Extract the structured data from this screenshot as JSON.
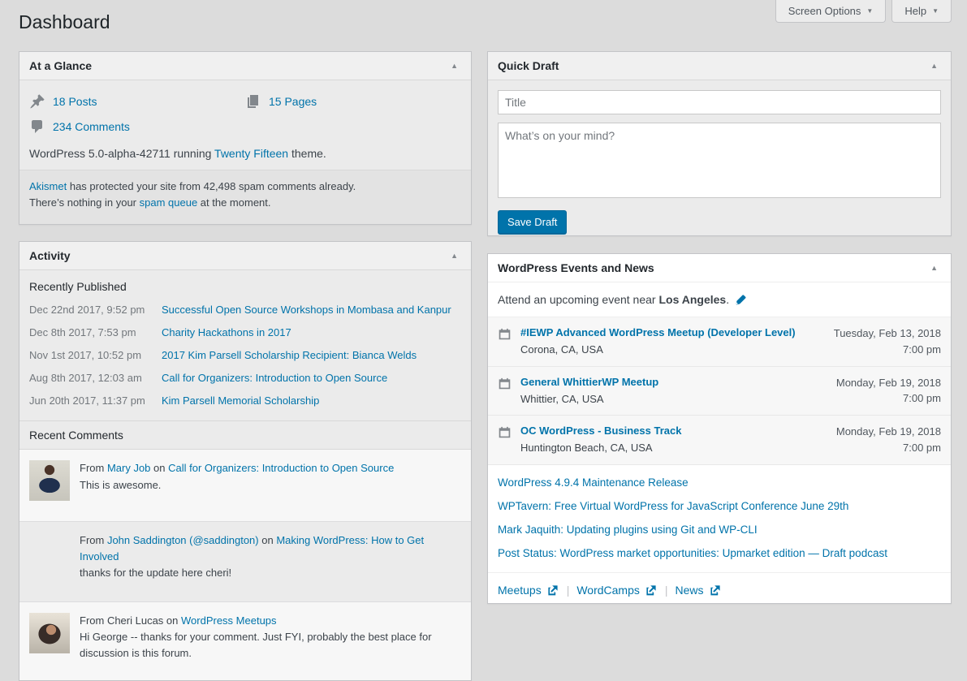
{
  "page": {
    "title": "Dashboard"
  },
  "toolbar": {
    "screen_options_label": "Screen Options",
    "help_label": "Help"
  },
  "icons": {
    "caret_down": "▼",
    "collapse_up": "▲",
    "divider": "|"
  },
  "at_a_glance": {
    "title": "At a Glance",
    "posts_link": "18 Posts",
    "pages_link": "15 Pages",
    "comments_link": "234 Comments",
    "version_prefix": "WordPress 5.0-alpha-42711 running ",
    "theme_link": "Twenty Fifteen",
    "version_suffix": " theme.",
    "akismet_link": "Akismet",
    "akismet_line1_rest": " has protected your site from 42,498 spam comments already.",
    "akismet_line2_prefix": "There’s nothing in your ",
    "spam_queue_link": "spam queue",
    "akismet_line2_suffix": " at the moment."
  },
  "activity": {
    "title": "Activity",
    "published_heading": "Recently Published",
    "published": [
      {
        "date": "Dec 22nd 2017, 9:52 pm",
        "title": "Successful Open Source Workshops in Mombasa and Kanpur"
      },
      {
        "date": "Dec 8th 2017, 7:53 pm",
        "title": "Charity Hackathons in 2017"
      },
      {
        "date": "Nov 1st 2017, 10:52 pm",
        "title": "2017 Kim Parsell Scholarship Recipient: Bianca Welds"
      },
      {
        "date": "Aug 8th 2017, 12:03 am",
        "title": "Call for Organizers: Introduction to Open Source"
      },
      {
        "date": "Jun 20th 2017, 11:37 pm",
        "title": "Kim Parsell Memorial Scholarship"
      }
    ],
    "comments_heading": "Recent Comments",
    "comments": [
      {
        "from": "From ",
        "author": "Mary Job",
        "on": " on ",
        "post": "Call for Organizers: Introduction to Open Source",
        "text": "This is awesome."
      },
      {
        "from": "From ",
        "author": "John Saddington (@saddington)",
        "on": " on ",
        "post": "Making WordPress: How to Get Involved",
        "text": "thanks for the update here cheri!"
      },
      {
        "from": "From Cheri Lucas on ",
        "author": "",
        "on": "",
        "post": "WordPress Meetups",
        "text": "Hi George -- thanks for your comment. Just FYI, probably the best place for discussion is this forum."
      }
    ]
  },
  "quick_draft": {
    "title": "Quick Draft",
    "title_placeholder": "Title",
    "content_placeholder": "What’s on your mind?",
    "save_label": "Save Draft"
  },
  "events": {
    "title": "WordPress Events and News",
    "attend_prefix": "Attend an upcoming event near ",
    "city": "Los Angeles",
    "attend_suffix": ".",
    "items": [
      {
        "title": "#IEWP Advanced WordPress Meetup (Developer Level)",
        "location": "Corona, CA, USA",
        "date": "Tuesday, Feb 13, 2018",
        "time": "7:00 pm"
      },
      {
        "title": "General WhittierWP Meetup",
        "location": "Whittier, CA, USA",
        "date": "Monday, Feb 19, 2018",
        "time": "7:00 pm"
      },
      {
        "title": "OC WordPress - Business Track",
        "location": "Huntington Beach, CA, USA",
        "date": "Monday, Feb 19, 2018",
        "time": "7:00 pm"
      }
    ],
    "news": [
      "WordPress 4.9.4 Maintenance Release",
      "WPTavern: Free Virtual WordPress for JavaScript Conference June 29th",
      "Mark Jaquith: Updating plugins using Git and WP-CLI",
      "Post Status: WordPress market opportunities: Upmarket edition — Draft podcast"
    ],
    "footer": {
      "meetups": "Meetups",
      "wordcamps": "WordCamps",
      "news": "News"
    }
  }
}
